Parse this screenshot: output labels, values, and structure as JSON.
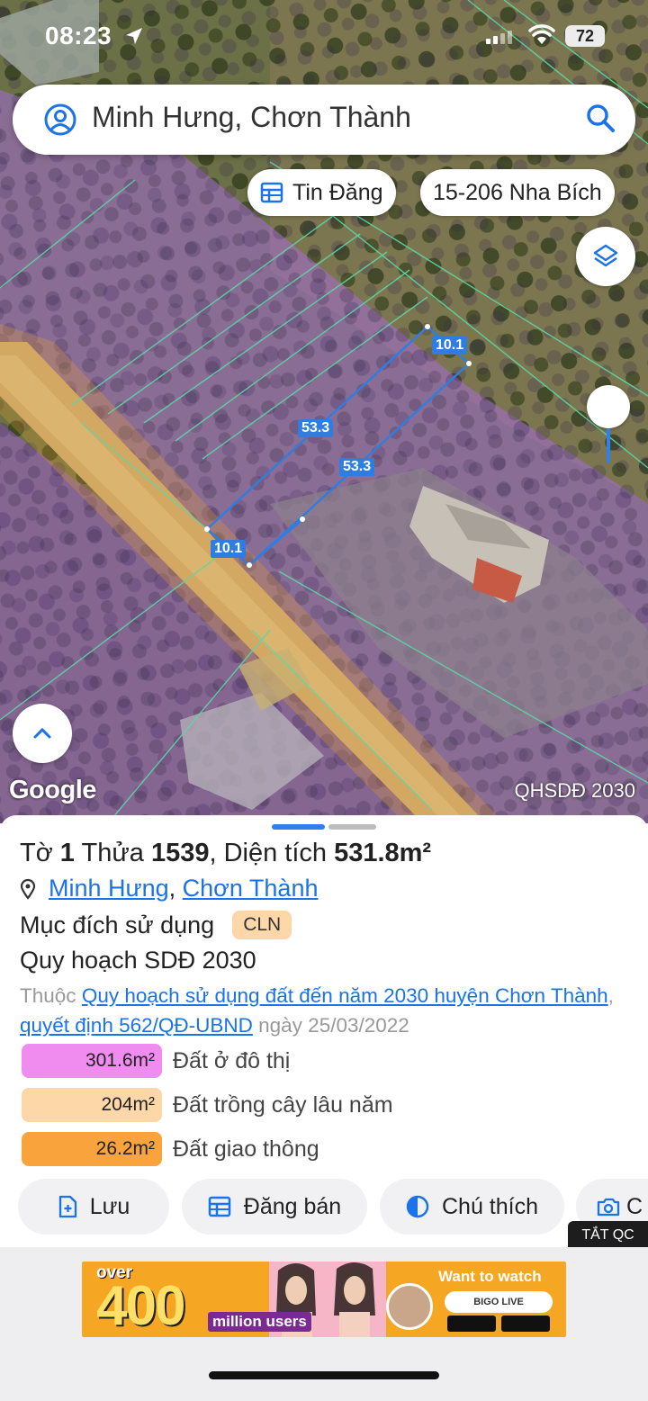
{
  "status_bar": {
    "time": "08:23",
    "battery": "72"
  },
  "search": {
    "query": "Minh Hưng, Chơn Thành"
  },
  "chips": {
    "listing": "Tin Đăng",
    "plan_code": "15-206 Nha Bích"
  },
  "map": {
    "google_logo": "Google",
    "plan_layer": "QHSDĐ 2030",
    "dimensions": {
      "top_width": "10.1",
      "left_length": "53.3",
      "right_length": "53.3",
      "bottom_width": "10.1"
    }
  },
  "sheet": {
    "title": {
      "to_label": "Tờ",
      "to_value": "1",
      "thua_label": "Thửa",
      "thua_value": "1539",
      "area_label": ", Diện tích",
      "area_value": "531.8m²"
    },
    "address": {
      "commune": "Minh Hưng",
      "separator": ",",
      "district": "Chơn Thành"
    },
    "purpose": {
      "label": "Mục đích sử dụng",
      "code": "CLN"
    },
    "plan_title": "Quy hoạch SDĐ 2030",
    "plan_desc": {
      "prefix": "Thuộc",
      "plan_link": "Quy hoạch sử dụng đất đến năm 2030 huyện Chơn Thành",
      "separator": ",",
      "decision_link": "quyết định 562/QĐ-UBND",
      "date": "ngày 25/03/2022"
    },
    "legend": [
      {
        "area": "301.6m²",
        "name": "Đất ở đô thị",
        "color": "#f08cf0"
      },
      {
        "area": "204m²",
        "name": "Đất trồng cây lâu năm",
        "color": "#fdd7a8"
      },
      {
        "area": "26.2m²",
        "name": "Đất giao thông",
        "color": "#f8a33c"
      }
    ],
    "actions": {
      "save": "Lưu",
      "post_sale": "Đăng bán",
      "legend": "Chú thích",
      "camera": "C"
    }
  },
  "ad": {
    "close_label": "TẮT QC",
    "over": "over",
    "big_number": "400",
    "million_users": "million users",
    "want": "Want to watch",
    "brand": "BIGO LIVE"
  },
  "colors": {
    "accent": "#1a73e8",
    "parcel": "#2f7de1"
  }
}
